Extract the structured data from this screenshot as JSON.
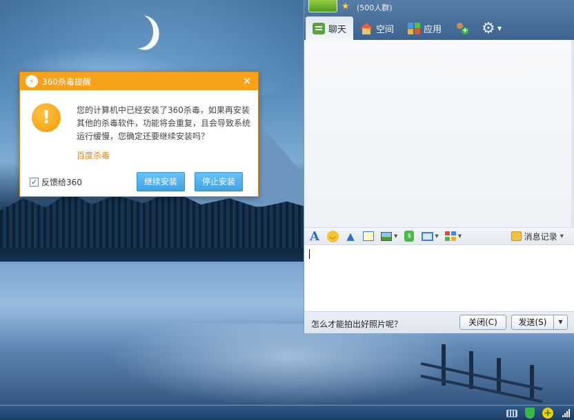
{
  "alert": {
    "title": "360杀毒提醒",
    "close_glyph": "✕",
    "warn_glyph": "!",
    "logo_glyph": "⚡",
    "message": "您的计算机中已经安装了360杀毒，如果再安装其他的杀毒软件，功能将会重复，且会导致系统运行缓慢，您确定还要继续安装吗？",
    "link": "百度杀毒",
    "feedback_label": "反馈给360",
    "feedback_checked": true,
    "continue_label": "继续安装",
    "stop_label": "停止安装",
    "accent": "#f7a21a"
  },
  "qq": {
    "star_glyph": "★",
    "group_count": "(500人群)",
    "tabs": [
      {
        "label": "聊天",
        "icon": "chat-icon",
        "active": true
      },
      {
        "label": "空间",
        "icon": "home-icon",
        "active": false
      },
      {
        "label": "应用",
        "icon": "apps-icon",
        "active": false
      }
    ],
    "add_member_icon": "add-user-icon",
    "settings_icon": "gear-icon",
    "toolbar": {
      "font_glyph": "A",
      "history_label": "消息记录"
    },
    "input_value": "",
    "footer": {
      "tip": "怎么才能拍出好照片呢？",
      "close_label": "关闭(C)",
      "send_label": "发送(S)"
    }
  },
  "taskbar": {
    "tray_icons": [
      "keyboard-icon",
      "shield-icon",
      "plus-icon",
      "signal-icon"
    ]
  }
}
